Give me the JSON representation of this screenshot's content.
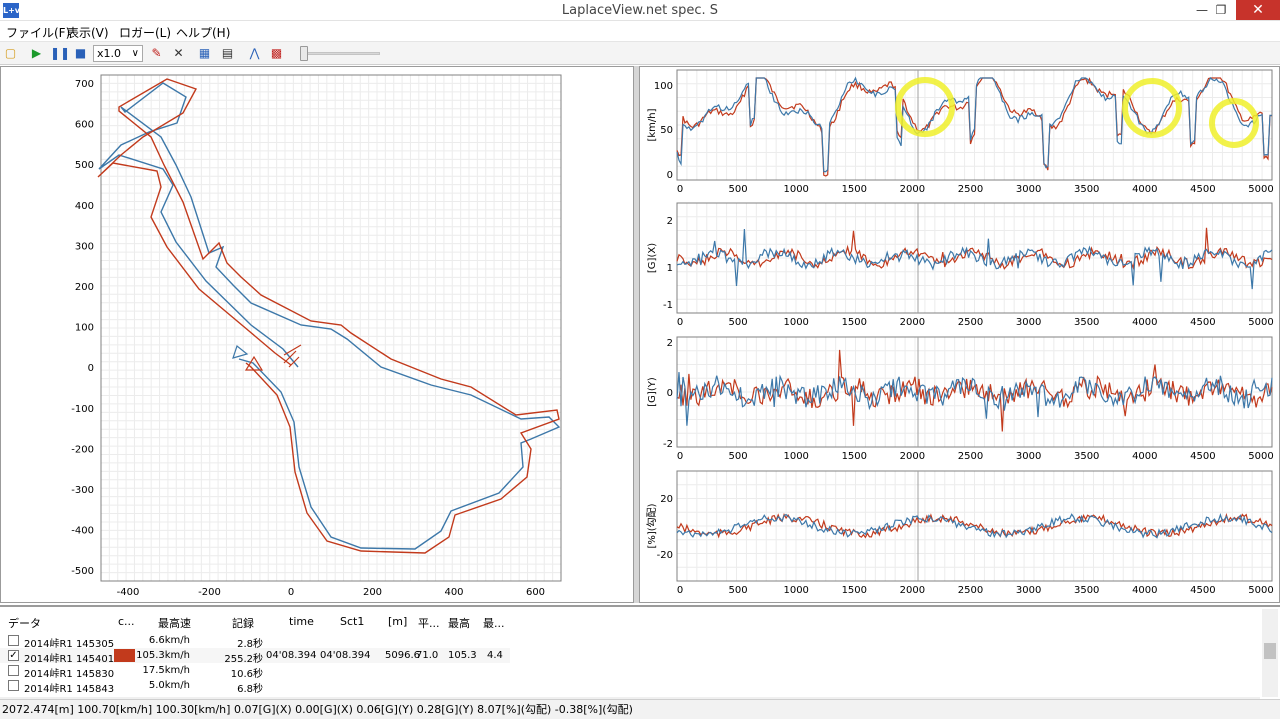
{
  "window": {
    "title": "LaplaceView.net spec. S",
    "logo": "L+v"
  },
  "colors": {
    "red_series": "#c23a1c",
    "blue_series": "#3d78a9",
    "highlight": "#f0f02a",
    "grid": "#e4e4e4"
  },
  "menu": [
    "ファイル(F)",
    "表示(V)",
    "ロガー(L)",
    "ヘルプ(H)"
  ],
  "toolbar": {
    "icons": [
      "folder-open-icon",
      "play-icon",
      "pause-icon",
      "stop-icon",
      "pen-icon",
      "delete-icon",
      "export-icon",
      "page-icon",
      "chart-icon",
      "pdf-icon"
    ],
    "speed": "x1.0"
  },
  "map": {
    "x_ticks": [
      "-400",
      "-200",
      "0",
      "200",
      "400",
      "600"
    ],
    "y_ticks": [
      "700",
      "600",
      "500",
      "400",
      "300",
      "200",
      "100",
      "0",
      "-100",
      "-200",
      "-300",
      "-400",
      "-500"
    ]
  },
  "charts": [
    {
      "ylabel": "[km/h]",
      "y_ticks": [
        "100",
        "50",
        "0"
      ],
      "x_ticks": [
        "0",
        "500",
        "1000",
        "1500",
        "2000",
        "2500",
        "3000",
        "3500",
        "4000",
        "4500",
        "5000"
      ]
    },
    {
      "ylabel": "[G](X)",
      "y_ticks": [
        "2",
        "1",
        "-1"
      ],
      "x_ticks": [
        "0",
        "500",
        "1000",
        "1500",
        "2000",
        "2500",
        "3000",
        "3500",
        "4000",
        "4500",
        "5000"
      ]
    },
    {
      "ylabel": "[G](Y)",
      "y_ticks": [
        "2",
        "0",
        "-2"
      ],
      "x_ticks": [
        "0",
        "500",
        "1000",
        "1500",
        "2000",
        "2500",
        "3000",
        "3500",
        "4000",
        "4500",
        "5000"
      ]
    },
    {
      "ylabel": "[%](勾配)",
      "y_ticks": [
        "20",
        "-20"
      ],
      "x_ticks": [
        "0",
        "500",
        "1000",
        "1500",
        "2000",
        "2500",
        "3000",
        "3500",
        "4000",
        "4500",
        "5000"
      ]
    }
  ],
  "table": {
    "headers": [
      "データ",
      "c...",
      "最高速",
      "記録",
      "time",
      "Sct1",
      "[m]",
      "平...",
      "最高",
      "最..."
    ],
    "rows": [
      {
        "checked": false,
        "name": "2014峠R1 145305",
        "color": "",
        "top_speed": "6.6km/h",
        "record": "2.8秒",
        "time": "",
        "sct1": "",
        "dist": "",
        "avg": "",
        "max": "",
        "min": ""
      },
      {
        "checked": true,
        "name": "2014峠R1 145401",
        "color": "#c23a1c",
        "top_speed": "105.3km/h",
        "record": "255.2秒",
        "time": "04'08.394",
        "sct1": "04'08.394",
        "dist": "5096.6",
        "avg": "71.0",
        "max": "105.3",
        "min": "4.4"
      },
      {
        "checked": false,
        "name": "2014峠R1 145830",
        "color": "",
        "top_speed": "17.5km/h",
        "record": "10.6秒",
        "time": "",
        "sct1": "",
        "dist": "",
        "avg": "",
        "max": "",
        "min": ""
      },
      {
        "checked": false,
        "name": "2014峠R1 145843",
        "color": "",
        "top_speed": "5.0km/h",
        "record": "6.8秒",
        "time": "",
        "sct1": "",
        "dist": "",
        "avg": "",
        "max": "",
        "min": ""
      }
    ]
  },
  "status": "2072.474[m]  100.70[km/h]  100.30[km/h]  0.07[G](X)  0.00[G](X)  0.06[G](Y)  0.28[G](Y)  8.07[%](勾配)  -0.38[%](勾配)"
}
